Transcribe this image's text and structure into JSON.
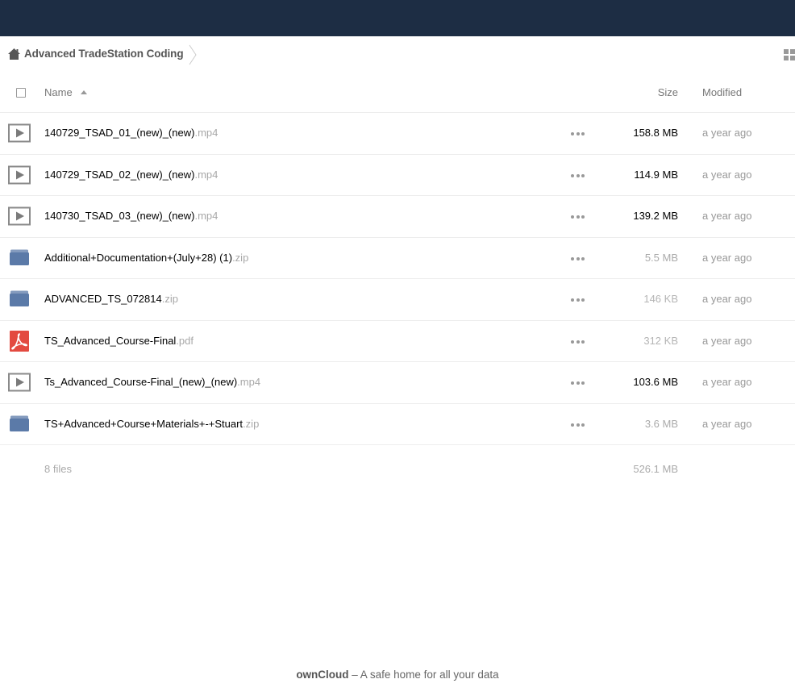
{
  "breadcrumb": {
    "folder": "Advanced TradeStation Coding"
  },
  "table": {
    "headers": {
      "name": "Name",
      "size": "Size",
      "modified": "Modified"
    },
    "files": [
      {
        "name": "140729_TSAD_01_(new)_(new)",
        "ext": ".mp4",
        "type": "video",
        "size": "158.8 MB",
        "size_color": "#000000",
        "modified": "a year ago"
      },
      {
        "name": "140729_TSAD_02_(new)_(new)",
        "ext": ".mp4",
        "type": "video",
        "size": "114.9 MB",
        "size_color": "#000000",
        "modified": "a year ago"
      },
      {
        "name": "140730_TSAD_03_(new)_(new)",
        "ext": ".mp4",
        "type": "video",
        "size": "139.2 MB",
        "size_color": "#000000",
        "modified": "a year ago"
      },
      {
        "name": "Additional+Documentation+(July+28) (1)",
        "ext": ".zip",
        "type": "archive",
        "size": "5.5 MB",
        "size_color": "#aaaaaa",
        "modified": "a year ago"
      },
      {
        "name": "ADVANCED_TS_072814",
        "ext": ".zip",
        "type": "archive",
        "size": "146 KB",
        "size_color": "#b5b5b5",
        "modified": "a year ago"
      },
      {
        "name": "TS_Advanced_Course-Final",
        "ext": ".pdf",
        "type": "pdf",
        "size": "312 KB",
        "size_color": "#b5b5b5",
        "modified": "a year ago"
      },
      {
        "name": "Ts_Advanced_Course-Final_(new)_(new)",
        "ext": ".mp4",
        "type": "video",
        "size": "103.6 MB",
        "size_color": "#000000",
        "modified": "a year ago"
      },
      {
        "name": "TS+Advanced+Course+Materials+-+Stuart",
        "ext": ".zip",
        "type": "archive",
        "size": "3.6 MB",
        "size_color": "#aaaaaa",
        "modified": "a year ago"
      }
    ]
  },
  "summary": {
    "count": "8 files",
    "total": "526.1 MB"
  },
  "footer": {
    "brand": "ownCloud",
    "tagline": " – A safe home for all your data"
  },
  "colors": {
    "topbar": "#1d2d44",
    "folder_icon": "#5b7aa8",
    "pdf_icon": "#e34a40"
  }
}
